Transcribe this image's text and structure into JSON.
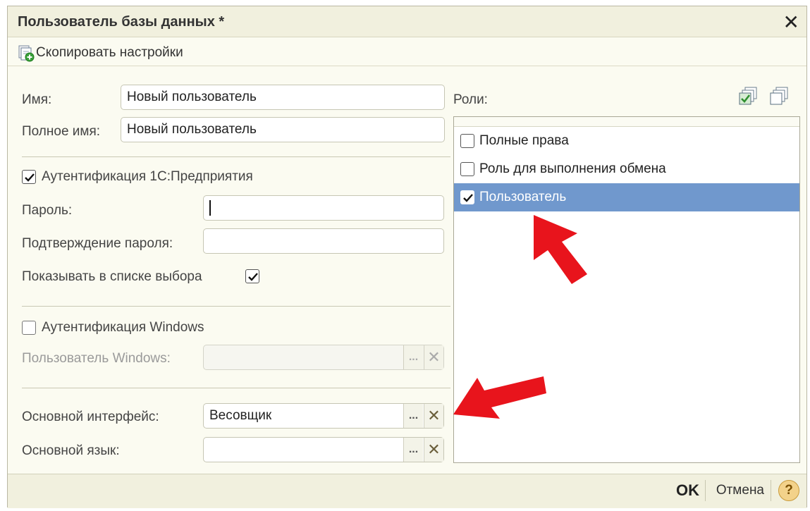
{
  "window": {
    "title": "Пользователь базы данных *",
    "close_glyph": "✕"
  },
  "toolbar": {
    "copy_label": "Скопировать настройки",
    "copy_icon": "copy-settings-icon"
  },
  "form": {
    "name_label": "Имя:",
    "name_value": "Новый пользователь",
    "fullname_label": "Полное имя:",
    "fullname_value": "Новый пользователь",
    "auth1c_label": "Аутентификация 1С:Предприятия",
    "auth1c_checked": true,
    "password_label": "Пароль:",
    "password_value": "",
    "confirm_label": "Подтверждение пароля:",
    "confirm_value": "",
    "show_in_list_label": "Показывать в списке выбора",
    "show_in_list_checked": true,
    "authwin_label": "Аутентификация Windows",
    "authwin_checked": false,
    "winuser_label": "Пользователь Windows:",
    "winuser_value": "",
    "interface_label": "Основной интерфейс:",
    "interface_value": "Весовщик",
    "language_label": "Основной язык:",
    "language_value": "",
    "ellipsis": "...",
    "clear": "✕"
  },
  "roles": {
    "label": "Роли:",
    "items": [
      {
        "label": "Полные права",
        "checked": false
      },
      {
        "label": "Роль для выполнения обмена",
        "checked": false
      },
      {
        "label": "Пользователь",
        "checked": true,
        "selected": true
      }
    ]
  },
  "footer": {
    "ok": "OK",
    "cancel": "Отмена",
    "help": "?"
  },
  "colors": {
    "selection": "#7098cd",
    "arrow": "#e8141c",
    "titlebar": "#f1f0de"
  }
}
